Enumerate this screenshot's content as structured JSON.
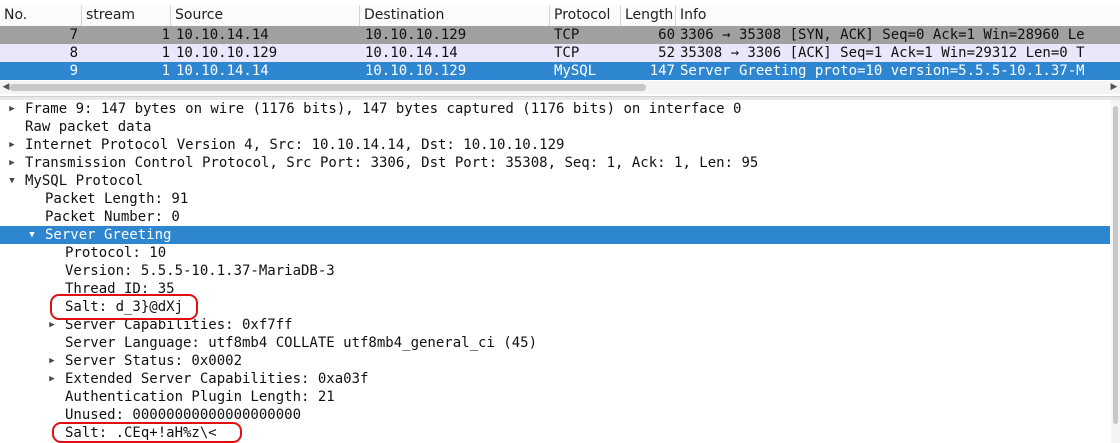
{
  "packet_list": {
    "columns": [
      "No.",
      "stream",
      "Source",
      "Destination",
      "Protocol",
      "Length",
      "Info"
    ],
    "rows": [
      {
        "no": "7",
        "stream": "1",
        "source": "10.10.14.14",
        "destination": "10.10.10.129",
        "protocol": "TCP",
        "length": "60",
        "info": "3306 → 35308 [SYN, ACK] Seq=0 Ack=1 Win=28960 Le"
      },
      {
        "no": "8",
        "stream": "1",
        "source": "10.10.10.129",
        "destination": "10.10.14.14",
        "protocol": "TCP",
        "length": "52",
        "info": "35308 → 3306 [ACK] Seq=1 Ack=1 Win=29312 Len=0 T"
      },
      {
        "no": "9",
        "stream": "1",
        "source": "10.10.14.14",
        "destination": "10.10.10.129",
        "protocol": "MySQL",
        "length": "147",
        "info": "Server Greeting proto=10 version=5.5.5-10.1.37-M"
      }
    ]
  },
  "details": {
    "frame": "Frame 9: 147 bytes on wire (1176 bits), 147 bytes captured (1176 bits) on interface 0",
    "raw": "Raw packet data",
    "ip": "Internet Protocol Version 4, Src: 10.10.14.14, Dst: 10.10.10.129",
    "tcp": "Transmission Control Protocol, Src Port: 3306, Dst Port: 35308, Seq: 1, Ack: 1, Len: 95",
    "mysql": "MySQL Protocol",
    "packet_length": "Packet Length: 91",
    "packet_number": "Packet Number: 0",
    "server_greeting": "Server Greeting",
    "protocol": "Protocol: 10",
    "version": "Version: 5.5.5-10.1.37-MariaDB-3",
    "thread_id": "Thread ID: 35",
    "salt1": "Salt: d_3}@dXj",
    "capabilities": "Server Capabilities: 0xf7ff",
    "language": "Server Language: utf8mb4 COLLATE utf8mb4_general_ci (45)",
    "status": "Server Status: 0x0002",
    "ext_capabilities": "Extended Server Capabilities: 0xa03f",
    "auth_plugin_length": "Authentication Plugin Length: 21",
    "unused": "Unused: 00000000000000000000",
    "salt2": "Salt: .CEq+!aH%z\\<"
  },
  "colors": {
    "selection": "#2f86d0",
    "row7": "#a0a0a0",
    "row8": "#ebe6fa",
    "annotation": "#e01010"
  },
  "icons": [
    "expand-triangle-icon",
    "collapse-triangle-icon",
    "scroll-left-icon",
    "scroll-right-icon"
  ]
}
